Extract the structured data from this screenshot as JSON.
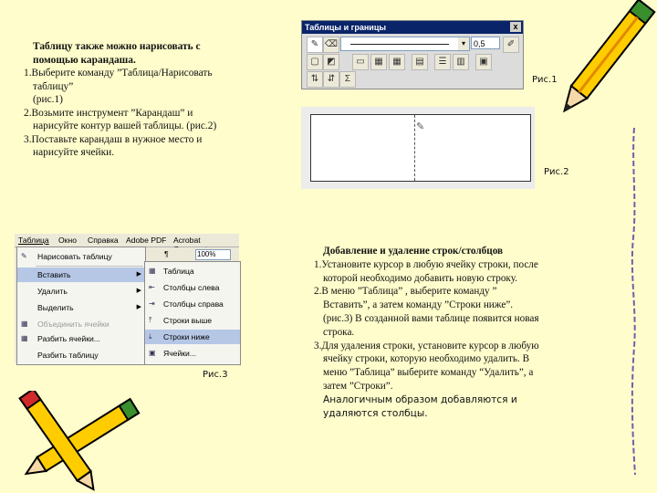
{
  "text1": {
    "title_line1": "Таблицу также можно нарисовать с",
    "title_line2": "помощью карандаша.",
    "item1_line1": "1.Выберите команду ”Таблица/Нарисовать",
    "item1_line2": "таблицу”",
    "item1_line3": "(рис.1)",
    "item2_line1": "2.Возьмите инструмент ”Карандаш” и",
    "item2_line2": "нарисуйте контур вашей таблицы. (рис.2)",
    "item3_line1": "3.Поставьте карандаш в нужное место и",
    "item3_line2": "нарисуйте ячейки."
  },
  "fig1": {
    "window_title": "Таблицы и границы",
    "close_glyph": "x",
    "line_weight": "0,5",
    "sigma": "Σ",
    "caption": "Рис.1"
  },
  "fig2": {
    "caption": "Рис.2"
  },
  "fig3": {
    "menubar": [
      "Таблица",
      "Окно",
      "Справка",
      "Adobe PDF",
      "Acrobat Comments"
    ],
    "menu": [
      "Нарисовать таблицу",
      "Вставить",
      "Удалить",
      "Выделить",
      "Объединить ячейки",
      "Разбить ячейки...",
      "Разбить таблицу"
    ],
    "submenu": [
      "Таблица",
      "Столбцы слева",
      "Столбцы справа",
      "Строки выше",
      "Строки ниже",
      "Ячейки..."
    ],
    "zoom": "100%",
    "pilcrow": "¶",
    "caption": "Рис.3"
  },
  "text2": {
    "title": "Добавление и удаление строк/столбцов",
    "l1": "1.Установите курсор в любую ячейку строки, после",
    "l2": "которой необходимо добавить новую строку.",
    "l3": "2.В меню ”Таблица” , выберите команду ”",
    "l4": "Вставить”, а затем команду ”Строки ниже”.",
    "l5": "(рис.3) В созданной вами таблице появится новая",
    "l6": "строка.",
    "l7": "3.Для удаления строки, установите курсор в любую",
    "l8": "ячейку строки, которую необходимо удалить. В",
    "l9": "меню ”Таблица” выберите команду “Удалить”, а",
    "l10": "затем ”Строки”.",
    "l11": "Аналогичным образом добавляются и",
    "l12": "удаляются столбцы."
  },
  "colors": {
    "background": "#fffdcc",
    "highlight": "#b6c7e6",
    "title_bar": "#0a246a"
  },
  "icons": [
    "pencil-icon",
    "eraser-icon",
    "border-icon",
    "shading-icon",
    "table-icon",
    "sigma-icon",
    "menu-arrow-icon"
  ]
}
